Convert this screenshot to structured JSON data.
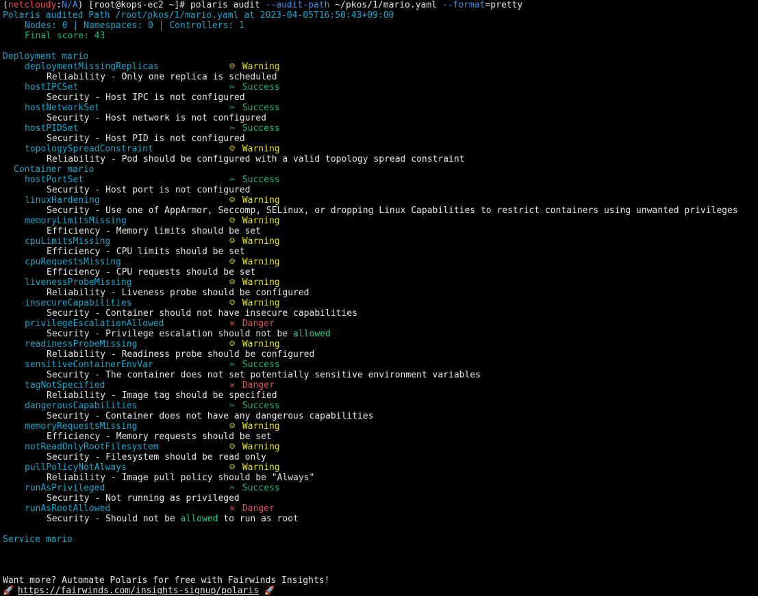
{
  "prompt": {
    "open": "(",
    "env": "netcloudy",
    "sep": ":",
    "ctx": "N/A",
    "close": ")",
    "user": "[root@kops-ec2 ~]#",
    "cmd": "polaris audit",
    "flag1": "--audit-path",
    "path": "~/pkos/1/mario.yaml",
    "flag2": "--format",
    "flag2_value": "=pretty"
  },
  "header": {
    "audited": "Polaris audited Path /root/pkos/1/mario.yaml at 2023-04-05T16:50:43+09:00",
    "counts": "Nodes: 0 | Namespaces: 0 | Controllers: 1",
    "score": "Final score: 43"
  },
  "deployment_title": "Deployment mario",
  "container_title": "Container mario",
  "service_title": "Service mario",
  "status_labels": {
    "warning": "Warning",
    "success": "Success",
    "danger": "Danger"
  },
  "icons": {
    "warning": "smiley-icon",
    "success": "celebration-icon",
    "danger": "cross-icon"
  },
  "deployment_checks": [
    {
      "name": "deploymentMissingReplicas",
      "status": "Warning",
      "desc": "Reliability - Only one replica is scheduled"
    },
    {
      "name": "hostIPCSet",
      "status": "Success",
      "desc": "Security - Host IPC is not configured"
    },
    {
      "name": "hostNetworkSet",
      "status": "Success",
      "desc": "Security - Host network is not configured"
    },
    {
      "name": "hostPIDSet",
      "status": "Success",
      "desc": "Security - Host PID is not configured"
    },
    {
      "name": "topologySpreadConstraint",
      "status": "Warning",
      "desc": "Reliability - Pod should be configured with a valid topology spread constraint"
    }
  ],
  "container_checks": [
    {
      "name": "hostPortSet",
      "status": "Success",
      "desc": "Security - Host port is not configured"
    },
    {
      "name": "linuxHardening",
      "status": "Warning",
      "desc": "Security - Use one of AppArmor, Seccomp, SELinux, or dropping Linux Capabilities to restrict containers using unwanted privileges"
    },
    {
      "name": "memoryLimitsMissing",
      "status": "Warning",
      "desc": "Efficiency - Memory limits should be set"
    },
    {
      "name": "cpuLimitsMissing",
      "status": "Warning",
      "desc": "Efficiency - CPU limits should be set"
    },
    {
      "name": "cpuRequestsMissing",
      "status": "Warning",
      "desc": "Efficiency - CPU requests should be set"
    },
    {
      "name": "livenessProbeMissing",
      "status": "Warning",
      "desc": "Reliability - Liveness probe should be configured"
    },
    {
      "name": "insecureCapabilities",
      "status": "Warning",
      "desc": "Security - Container should not have insecure capabilities"
    },
    {
      "name": "privilegeEscalationAllowed",
      "status": "Danger",
      "desc_pre": "Security - Privilege escalation should not be ",
      "desc_hl": "allowed",
      "desc_post": ""
    },
    {
      "name": "readinessProbeMissing",
      "status": "Warning",
      "desc": "Reliability - Readiness probe should be configured"
    },
    {
      "name": "sensitiveContainerEnvVar",
      "status": "Success",
      "desc": "Security - The container does not set potentially sensitive environment variables"
    },
    {
      "name": "tagNotSpecified",
      "status": "Danger",
      "desc": "Reliability - Image tag should be specified"
    },
    {
      "name": "dangerousCapabilities",
      "status": "Success",
      "desc": "Security - Container does not have any dangerous capabilities"
    },
    {
      "name": "memoryRequestsMissing",
      "status": "Warning",
      "desc": "Efficiency - Memory requests should be set"
    },
    {
      "name": "notReadOnlyRootFilesystem",
      "status": "Warning",
      "desc": "Security - Filesystem should be read only"
    },
    {
      "name": "pullPolicyNotAlways",
      "status": "Warning",
      "desc": "Reliability - Image pull policy should be \"Always\""
    },
    {
      "name": "runAsPrivileged",
      "status": "Success",
      "desc": "Security - Not running as privileged"
    },
    {
      "name": "runAsRootAllowed",
      "status": "Danger",
      "desc_pre": "Security - Should not be ",
      "desc_hl": "allowed",
      "desc_post": " to run as root"
    }
  ],
  "footer": {
    "promo": "Want more? Automate Polaris for free with Fairwinds Insights!",
    "url": "https://fairwinds.com/insights-signup/polaris"
  }
}
